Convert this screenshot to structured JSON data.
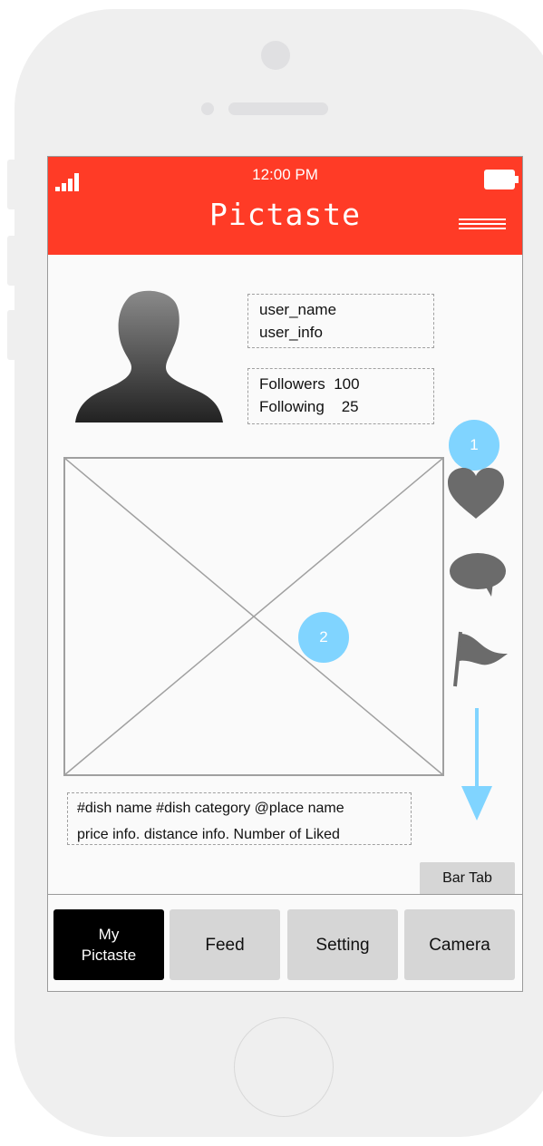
{
  "status_bar": {
    "time": "12:00 PM"
  },
  "app": {
    "title": "Pictaste"
  },
  "profile": {
    "user_name": "user_name",
    "user_info": "user_info",
    "followers_label": "Followers",
    "followers_count": "100",
    "following_label": "Following",
    "following_count": "25"
  },
  "annotations": {
    "badge_1": "1",
    "badge_2": "2"
  },
  "post": {
    "line1": "#dish name  #dish category @place name",
    "line2": "price info.  distance info.  Number of Liked"
  },
  "bar_tab_label": "Bar Tab",
  "tabs": [
    {
      "line1": "My",
      "line2": "Pictaste"
    },
    {
      "label": "Feed"
    },
    {
      "label": "Setting"
    },
    {
      "label": "Camera"
    }
  ],
  "colors": {
    "header": "#ff3b26",
    "badge": "#80d4ff",
    "arrow": "#80d4ff",
    "active_tab": "#000000",
    "tab": "#d6d6d6",
    "icon": "#6b6b6b"
  },
  "icons": [
    "signal-icon",
    "battery-icon",
    "hamburger-menu-icon",
    "avatar-silhouette-icon",
    "image-placeholder-icon",
    "heart-icon",
    "comment-icon",
    "flag-icon",
    "down-arrow-icon"
  ]
}
